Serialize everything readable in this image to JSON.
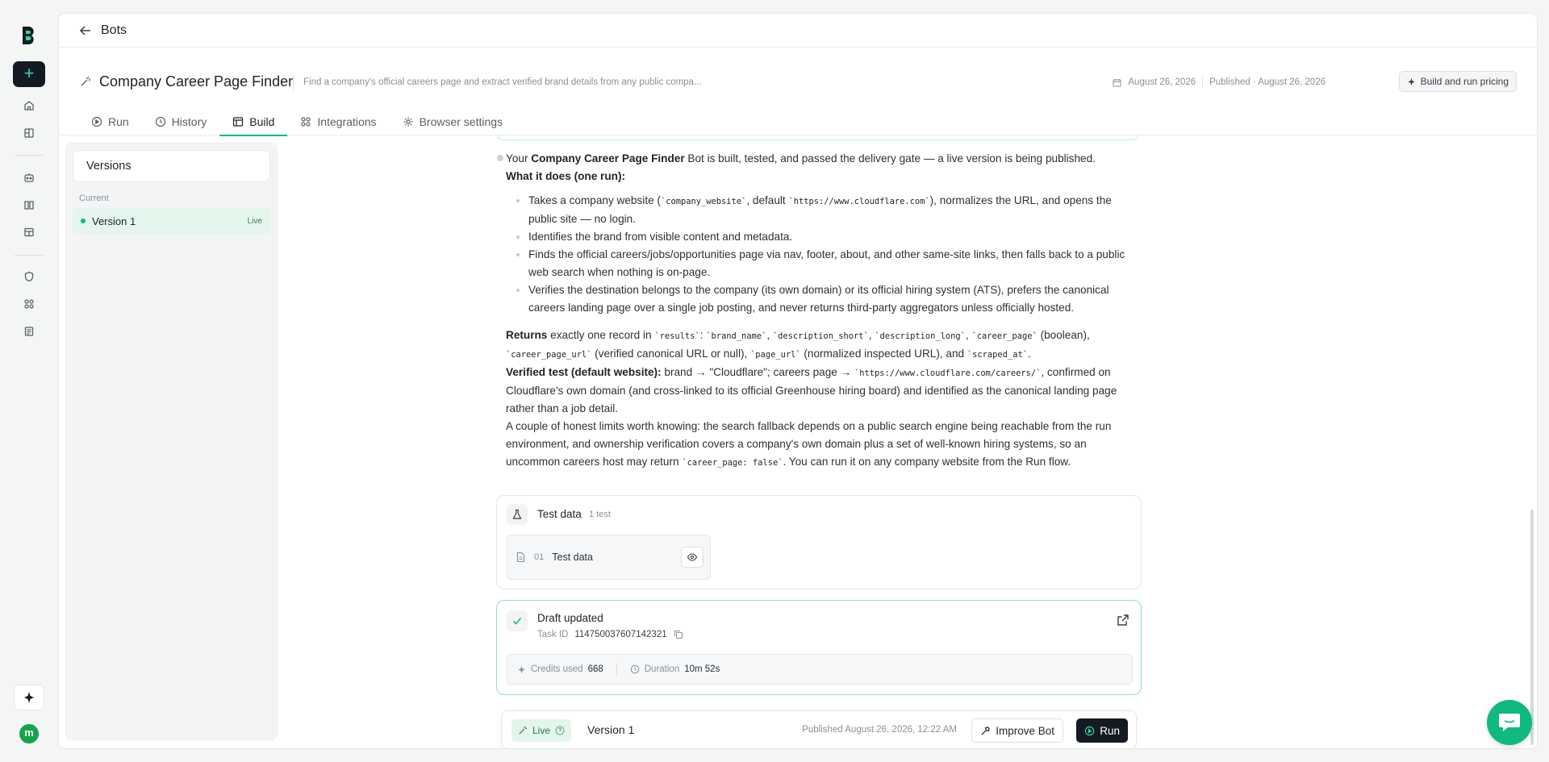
{
  "nav": {
    "back_title": "Bots"
  },
  "bot": {
    "name": "Company Career Page Finder",
    "description": "Find a company's official careers page and extract verified brand details from any public compa...",
    "created": "August 26, 2026",
    "published": "Published · August 26, 2026",
    "pricing_label": "Build and run pricing"
  },
  "tabs": [
    {
      "label": "Run"
    },
    {
      "label": "History"
    },
    {
      "label": "Build"
    },
    {
      "label": "Integrations"
    },
    {
      "label": "Browser settings"
    }
  ],
  "versions": {
    "title": "Versions",
    "current_label": "Current",
    "items": [
      {
        "label": "Version 1",
        "badge": "Live"
      }
    ]
  },
  "message": {
    "intro_a": "Your ",
    "intro_bold": "Company Career Page Finder",
    "intro_b": " Bot is built, tested, and passed the delivery gate — a live version is being published.",
    "what_heading": "What it does (one run):",
    "b1_a": "Takes a company website (",
    "b1_code1": "`company_website`",
    "b1_b": ", default ",
    "b1_code2": "`https://www.cloudflare.com`",
    "b1_c": "), normalizes the URL, and opens the public site — no login.",
    "b2": "Identifies the brand from visible content and metadata.",
    "b3": "Finds the official careers/jobs/opportunities page via nav, footer, about, and other same-site links, then falls back to a public web search when nothing is on-page.",
    "b4": "Verifies the destination belongs to the company (its own domain) or its official hiring system (ATS), prefers the canonical careers landing page over a single job posting, and never returns third-party aggregators unless officially hosted.",
    "ret_bold": "Returns",
    "ret_a": " exactly one record in ",
    "ret_c1": "`results`",
    "ret_b": ": ",
    "ret_c2": "`brand_name`",
    "ret_sep1": ", ",
    "ret_c3": "`description_short`",
    "ret_sep2": ", ",
    "ret_c4": "`description_long`",
    "ret_sep3": ", ",
    "ret_c5": "`career_page`",
    "ret_d": " (boolean), ",
    "ret_c6": "`career_page_url`",
    "ret_e": " (verified canonical URL or null), ",
    "ret_c7": "`page_url`",
    "ret_f": " (normalized inspected URL), and ",
    "ret_c8": "`scraped_at`",
    "ret_g": ".",
    "ver_bold": "Verified test (default website):",
    "ver_a": " brand → \"Cloudflare\"; careers page → ",
    "ver_code": "`https://www.cloudflare.com/careers/`",
    "ver_b": ", confirmed on Cloudflare's own domain (and cross-linked to its official Greenhouse hiring board) and identified as the canonical landing page rather than a job detail.",
    "lim_a": "A couple of honest limits worth knowing: the search fallback depends on a public search engine being reachable from the run environment, and ownership verification covers a company's own domain plus a set of well-known hiring systems, so an uncommon careers host may return ",
    "lim_code": "`career_page: false`",
    "lim_b": ". You can run it on any company website from the Run flow."
  },
  "test_data": {
    "title": "Test data",
    "count": "1 test",
    "item_num": "01",
    "item_name": "Test data"
  },
  "draft": {
    "title": "Draft updated",
    "task_label": "Task ID",
    "task_id": "114750037607142321",
    "credits_label": "Credits used",
    "credits": "668",
    "duration_label": "Duration",
    "duration": "10m 52s"
  },
  "livebar": {
    "live": "Live",
    "version": "Version 1",
    "published": "Published August 26, 2026, 12:22 AM",
    "improve": "Improve Bot",
    "run": "Run"
  },
  "user": {
    "initial": "m"
  },
  "colors": {
    "accent": "#10b981",
    "dark": "#141a24",
    "live_bg": "#e3f5ec"
  }
}
